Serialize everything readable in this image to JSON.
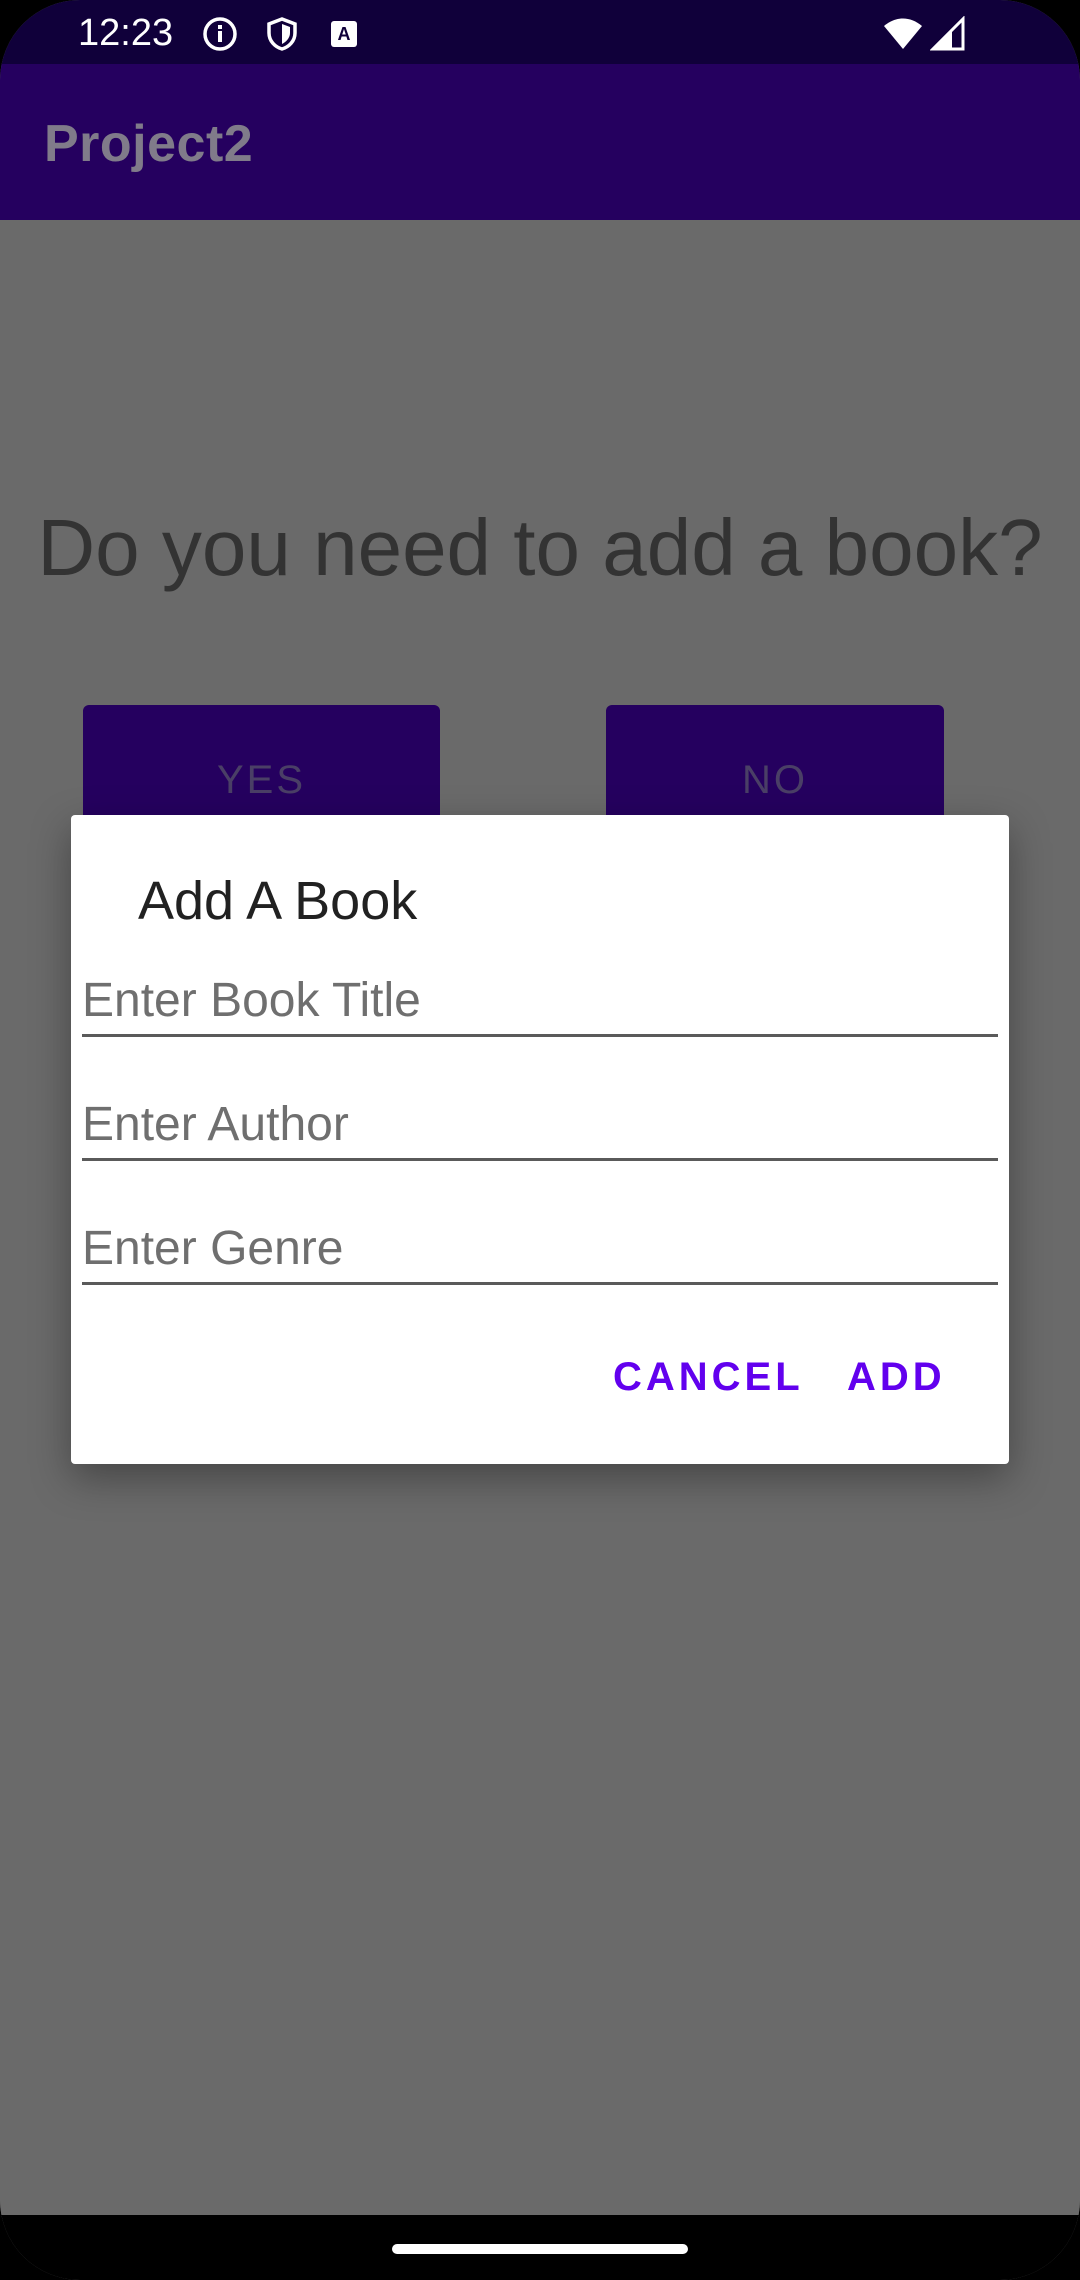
{
  "status_bar": {
    "time": "12:23",
    "icons_left": [
      "info-icon",
      "shield-icon",
      "keyboard-a-icon"
    ],
    "icons_right": [
      "wifi-icon",
      "signal-icon"
    ]
  },
  "app_bar": {
    "title": "Project2"
  },
  "main": {
    "question": "Do you need to add a book?",
    "yes_label": "YES",
    "no_label": "NO"
  },
  "dialog": {
    "title": "Add A Book",
    "fields": [
      {
        "placeholder": "Enter Book Title",
        "value": ""
      },
      {
        "placeholder": "Enter Author",
        "value": ""
      },
      {
        "placeholder": "Enter Genre",
        "value": ""
      }
    ],
    "cancel_label": "CANCEL",
    "add_label": "ADD"
  },
  "colors": {
    "primary": "#25005f",
    "status_bar": "#10003a",
    "accent": "#6200ee",
    "scrim": "#6a6a6a"
  }
}
